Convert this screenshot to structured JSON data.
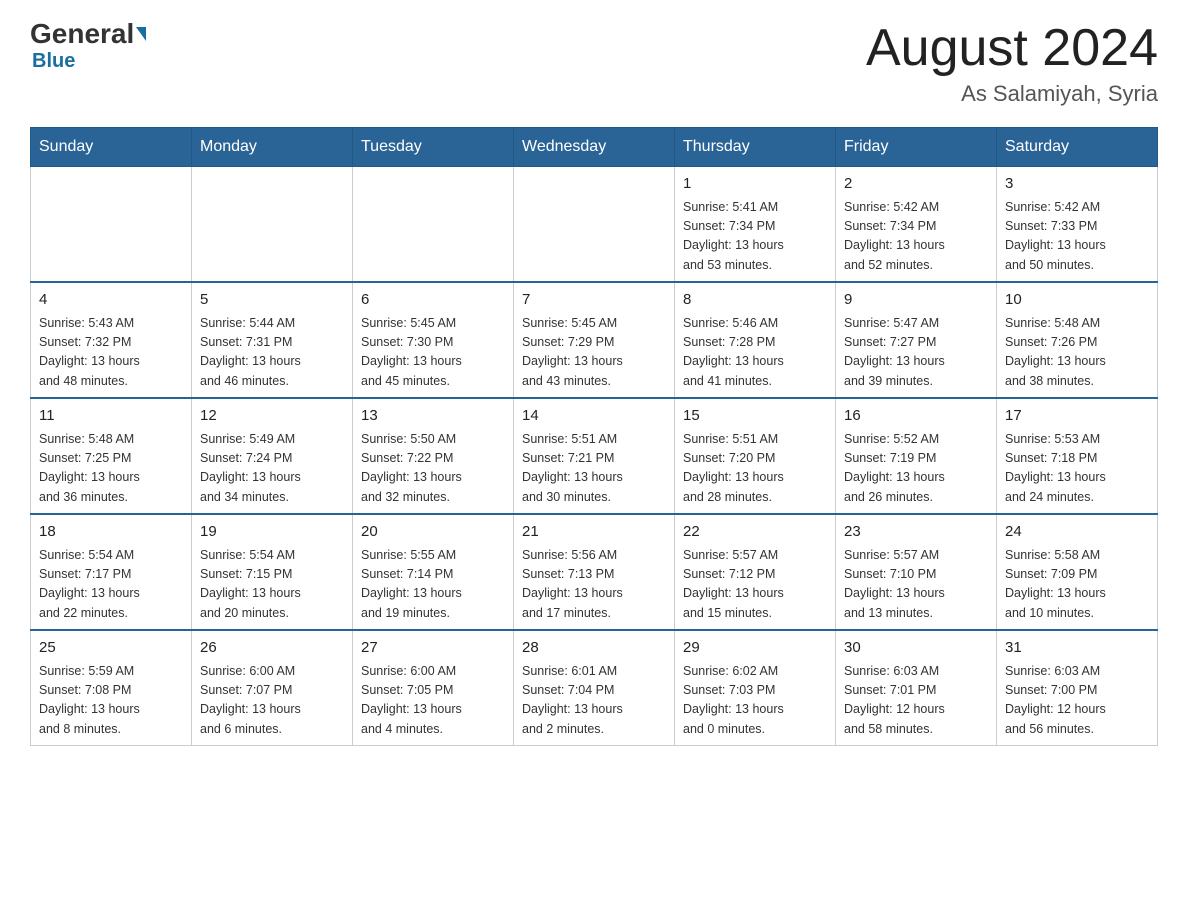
{
  "header": {
    "logo_general": "General",
    "logo_blue": "Blue",
    "month_title": "August 2024",
    "subtitle": "As Salamiyah, Syria"
  },
  "calendar": {
    "days_of_week": [
      "Sunday",
      "Monday",
      "Tuesday",
      "Wednesday",
      "Thursday",
      "Friday",
      "Saturday"
    ],
    "weeks": [
      [
        {
          "day": "",
          "info": ""
        },
        {
          "day": "",
          "info": ""
        },
        {
          "day": "",
          "info": ""
        },
        {
          "day": "",
          "info": ""
        },
        {
          "day": "1",
          "info": "Sunrise: 5:41 AM\nSunset: 7:34 PM\nDaylight: 13 hours\nand 53 minutes."
        },
        {
          "day": "2",
          "info": "Sunrise: 5:42 AM\nSunset: 7:34 PM\nDaylight: 13 hours\nand 52 minutes."
        },
        {
          "day": "3",
          "info": "Sunrise: 5:42 AM\nSunset: 7:33 PM\nDaylight: 13 hours\nand 50 minutes."
        }
      ],
      [
        {
          "day": "4",
          "info": "Sunrise: 5:43 AM\nSunset: 7:32 PM\nDaylight: 13 hours\nand 48 minutes."
        },
        {
          "day": "5",
          "info": "Sunrise: 5:44 AM\nSunset: 7:31 PM\nDaylight: 13 hours\nand 46 minutes."
        },
        {
          "day": "6",
          "info": "Sunrise: 5:45 AM\nSunset: 7:30 PM\nDaylight: 13 hours\nand 45 minutes."
        },
        {
          "day": "7",
          "info": "Sunrise: 5:45 AM\nSunset: 7:29 PM\nDaylight: 13 hours\nand 43 minutes."
        },
        {
          "day": "8",
          "info": "Sunrise: 5:46 AM\nSunset: 7:28 PM\nDaylight: 13 hours\nand 41 minutes."
        },
        {
          "day": "9",
          "info": "Sunrise: 5:47 AM\nSunset: 7:27 PM\nDaylight: 13 hours\nand 39 minutes."
        },
        {
          "day": "10",
          "info": "Sunrise: 5:48 AM\nSunset: 7:26 PM\nDaylight: 13 hours\nand 38 minutes."
        }
      ],
      [
        {
          "day": "11",
          "info": "Sunrise: 5:48 AM\nSunset: 7:25 PM\nDaylight: 13 hours\nand 36 minutes."
        },
        {
          "day": "12",
          "info": "Sunrise: 5:49 AM\nSunset: 7:24 PM\nDaylight: 13 hours\nand 34 minutes."
        },
        {
          "day": "13",
          "info": "Sunrise: 5:50 AM\nSunset: 7:22 PM\nDaylight: 13 hours\nand 32 minutes."
        },
        {
          "day": "14",
          "info": "Sunrise: 5:51 AM\nSunset: 7:21 PM\nDaylight: 13 hours\nand 30 minutes."
        },
        {
          "day": "15",
          "info": "Sunrise: 5:51 AM\nSunset: 7:20 PM\nDaylight: 13 hours\nand 28 minutes."
        },
        {
          "day": "16",
          "info": "Sunrise: 5:52 AM\nSunset: 7:19 PM\nDaylight: 13 hours\nand 26 minutes."
        },
        {
          "day": "17",
          "info": "Sunrise: 5:53 AM\nSunset: 7:18 PM\nDaylight: 13 hours\nand 24 minutes."
        }
      ],
      [
        {
          "day": "18",
          "info": "Sunrise: 5:54 AM\nSunset: 7:17 PM\nDaylight: 13 hours\nand 22 minutes."
        },
        {
          "day": "19",
          "info": "Sunrise: 5:54 AM\nSunset: 7:15 PM\nDaylight: 13 hours\nand 20 minutes."
        },
        {
          "day": "20",
          "info": "Sunrise: 5:55 AM\nSunset: 7:14 PM\nDaylight: 13 hours\nand 19 minutes."
        },
        {
          "day": "21",
          "info": "Sunrise: 5:56 AM\nSunset: 7:13 PM\nDaylight: 13 hours\nand 17 minutes."
        },
        {
          "day": "22",
          "info": "Sunrise: 5:57 AM\nSunset: 7:12 PM\nDaylight: 13 hours\nand 15 minutes."
        },
        {
          "day": "23",
          "info": "Sunrise: 5:57 AM\nSunset: 7:10 PM\nDaylight: 13 hours\nand 13 minutes."
        },
        {
          "day": "24",
          "info": "Sunrise: 5:58 AM\nSunset: 7:09 PM\nDaylight: 13 hours\nand 10 minutes."
        }
      ],
      [
        {
          "day": "25",
          "info": "Sunrise: 5:59 AM\nSunset: 7:08 PM\nDaylight: 13 hours\nand 8 minutes."
        },
        {
          "day": "26",
          "info": "Sunrise: 6:00 AM\nSunset: 7:07 PM\nDaylight: 13 hours\nand 6 minutes."
        },
        {
          "day": "27",
          "info": "Sunrise: 6:00 AM\nSunset: 7:05 PM\nDaylight: 13 hours\nand 4 minutes."
        },
        {
          "day": "28",
          "info": "Sunrise: 6:01 AM\nSunset: 7:04 PM\nDaylight: 13 hours\nand 2 minutes."
        },
        {
          "day": "29",
          "info": "Sunrise: 6:02 AM\nSunset: 7:03 PM\nDaylight: 13 hours\nand 0 minutes."
        },
        {
          "day": "30",
          "info": "Sunrise: 6:03 AM\nSunset: 7:01 PM\nDaylight: 12 hours\nand 58 minutes."
        },
        {
          "day": "31",
          "info": "Sunrise: 6:03 AM\nSunset: 7:00 PM\nDaylight: 12 hours\nand 56 minutes."
        }
      ]
    ]
  }
}
